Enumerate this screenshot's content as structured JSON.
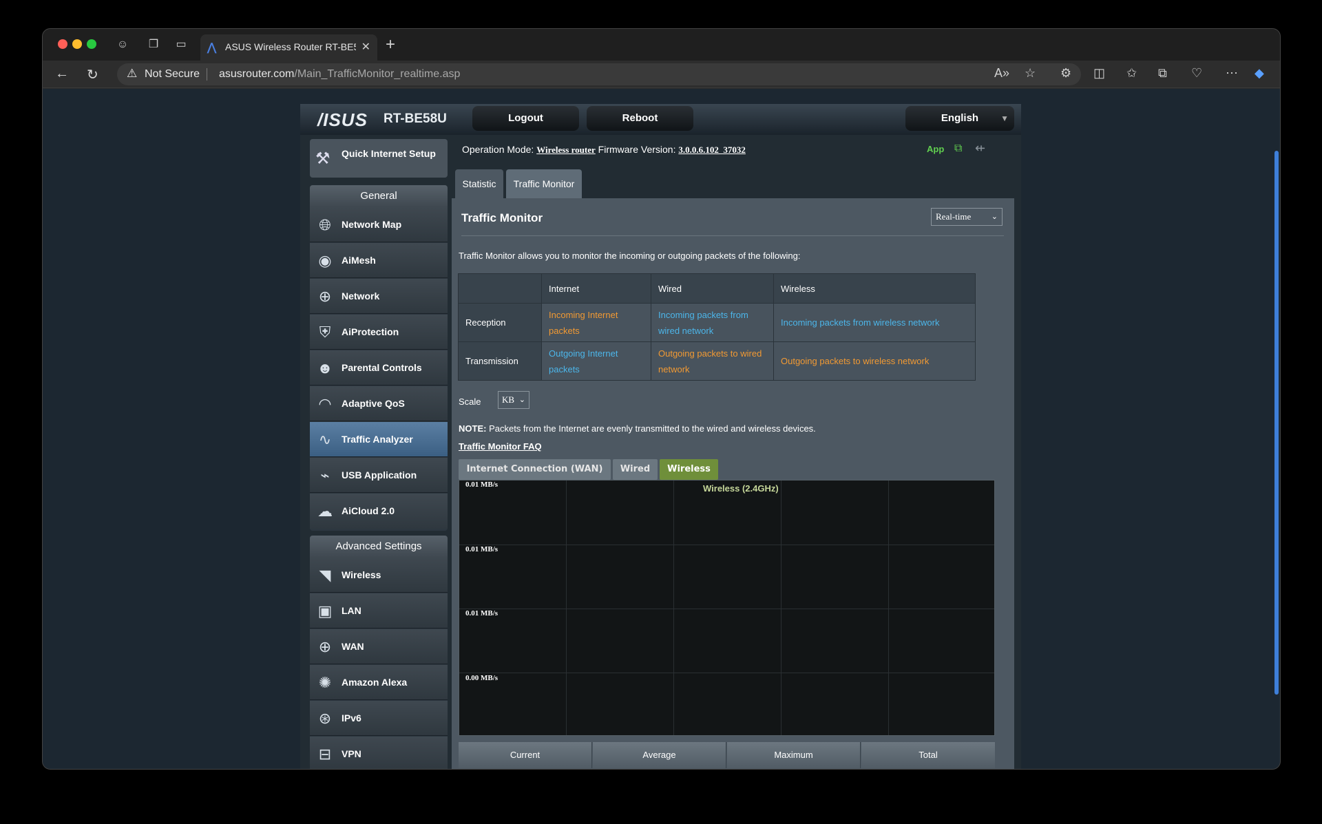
{
  "browser": {
    "tab_title": "ASUS Wireless Router RT-BE5",
    "security_label": "Not Secure",
    "url_host": "asusrouter.com",
    "url_path": "/Main_TrafficMonitor_realtime.asp"
  },
  "router": {
    "brand": "/ISUS",
    "model": "RT-BE58U",
    "logout_label": "Logout",
    "reboot_label": "Reboot",
    "language": "English",
    "operation_mode_label": "Operation Mode:",
    "operation_mode_value": "Wireless router",
    "firmware_label": "Firmware Version:",
    "firmware_value": "3.0.0.6.102_37032",
    "app_label": "App"
  },
  "sidebar": {
    "quick_setup_label": "Quick Internet Setup",
    "general_title": "General",
    "general_items": [
      {
        "label": "Network Map",
        "icon": "globe-icon"
      },
      {
        "label": "AiMesh",
        "icon": "mesh-icon"
      },
      {
        "label": "Network",
        "icon": "network-icon"
      },
      {
        "label": "AiProtection",
        "icon": "shield-icon"
      },
      {
        "label": "Parental Controls",
        "icon": "family-icon"
      },
      {
        "label": "Adaptive QoS",
        "icon": "gauge-icon"
      },
      {
        "label": "Traffic Analyzer",
        "icon": "pulse-icon",
        "active": true
      },
      {
        "label": "USB Application",
        "icon": "usb-icon"
      },
      {
        "label": "AiCloud 2.0",
        "icon": "cloud-icon"
      }
    ],
    "advanced_title": "Advanced Settings",
    "advanced_items": [
      {
        "label": "Wireless",
        "icon": "wifi-icon"
      },
      {
        "label": "LAN",
        "icon": "monitor-icon"
      },
      {
        "label": "WAN",
        "icon": "globe-icon"
      },
      {
        "label": "Amazon Alexa",
        "icon": "alexa-icon"
      },
      {
        "label": "IPv6",
        "icon": "ipv6-icon"
      },
      {
        "label": "VPN",
        "icon": "vpn-icon"
      }
    ]
  },
  "main": {
    "tabs": [
      "Statistic",
      "Traffic Monitor"
    ],
    "title": "Traffic Monitor",
    "mode": "Real-time",
    "description": "Traffic Monitor allows you to monitor the incoming or outgoing packets of the following:",
    "table": {
      "headers": [
        "",
        "Internet",
        "Wired",
        "Wireless"
      ],
      "rows": [
        {
          "label": "Reception",
          "cells": [
            "Incoming Internet packets",
            "Incoming packets from wired network",
            "Incoming packets from wireless network"
          ]
        },
        {
          "label": "Transmission",
          "cells": [
            "Outgoing Internet packets",
            "Outgoing packets to wired network",
            "Outgoing packets to wireless network"
          ]
        }
      ]
    },
    "scale_label": "Scale",
    "scale_value": "KB",
    "note_label": "NOTE:",
    "note_text": " Packets from the Internet are evenly transmitted to the wired and wireless devices.",
    "faq_label": "Traffic Monitor FAQ",
    "graph_tabs": [
      "Internet Connection (WAN)",
      "Wired",
      "Wireless"
    ],
    "graph_title": "Wireless (2.4GHz)",
    "y_labels": [
      "0.01 MB/s",
      "0.01 MB/s",
      "0.01 MB/s",
      "0.00 MB/s"
    ],
    "stats": [
      "Current",
      "Average",
      "Maximum",
      "Total"
    ]
  },
  "colors": {
    "orange": "#f29a33",
    "blue": "#4cb6ea",
    "active_tab": "#6f8f3a"
  }
}
